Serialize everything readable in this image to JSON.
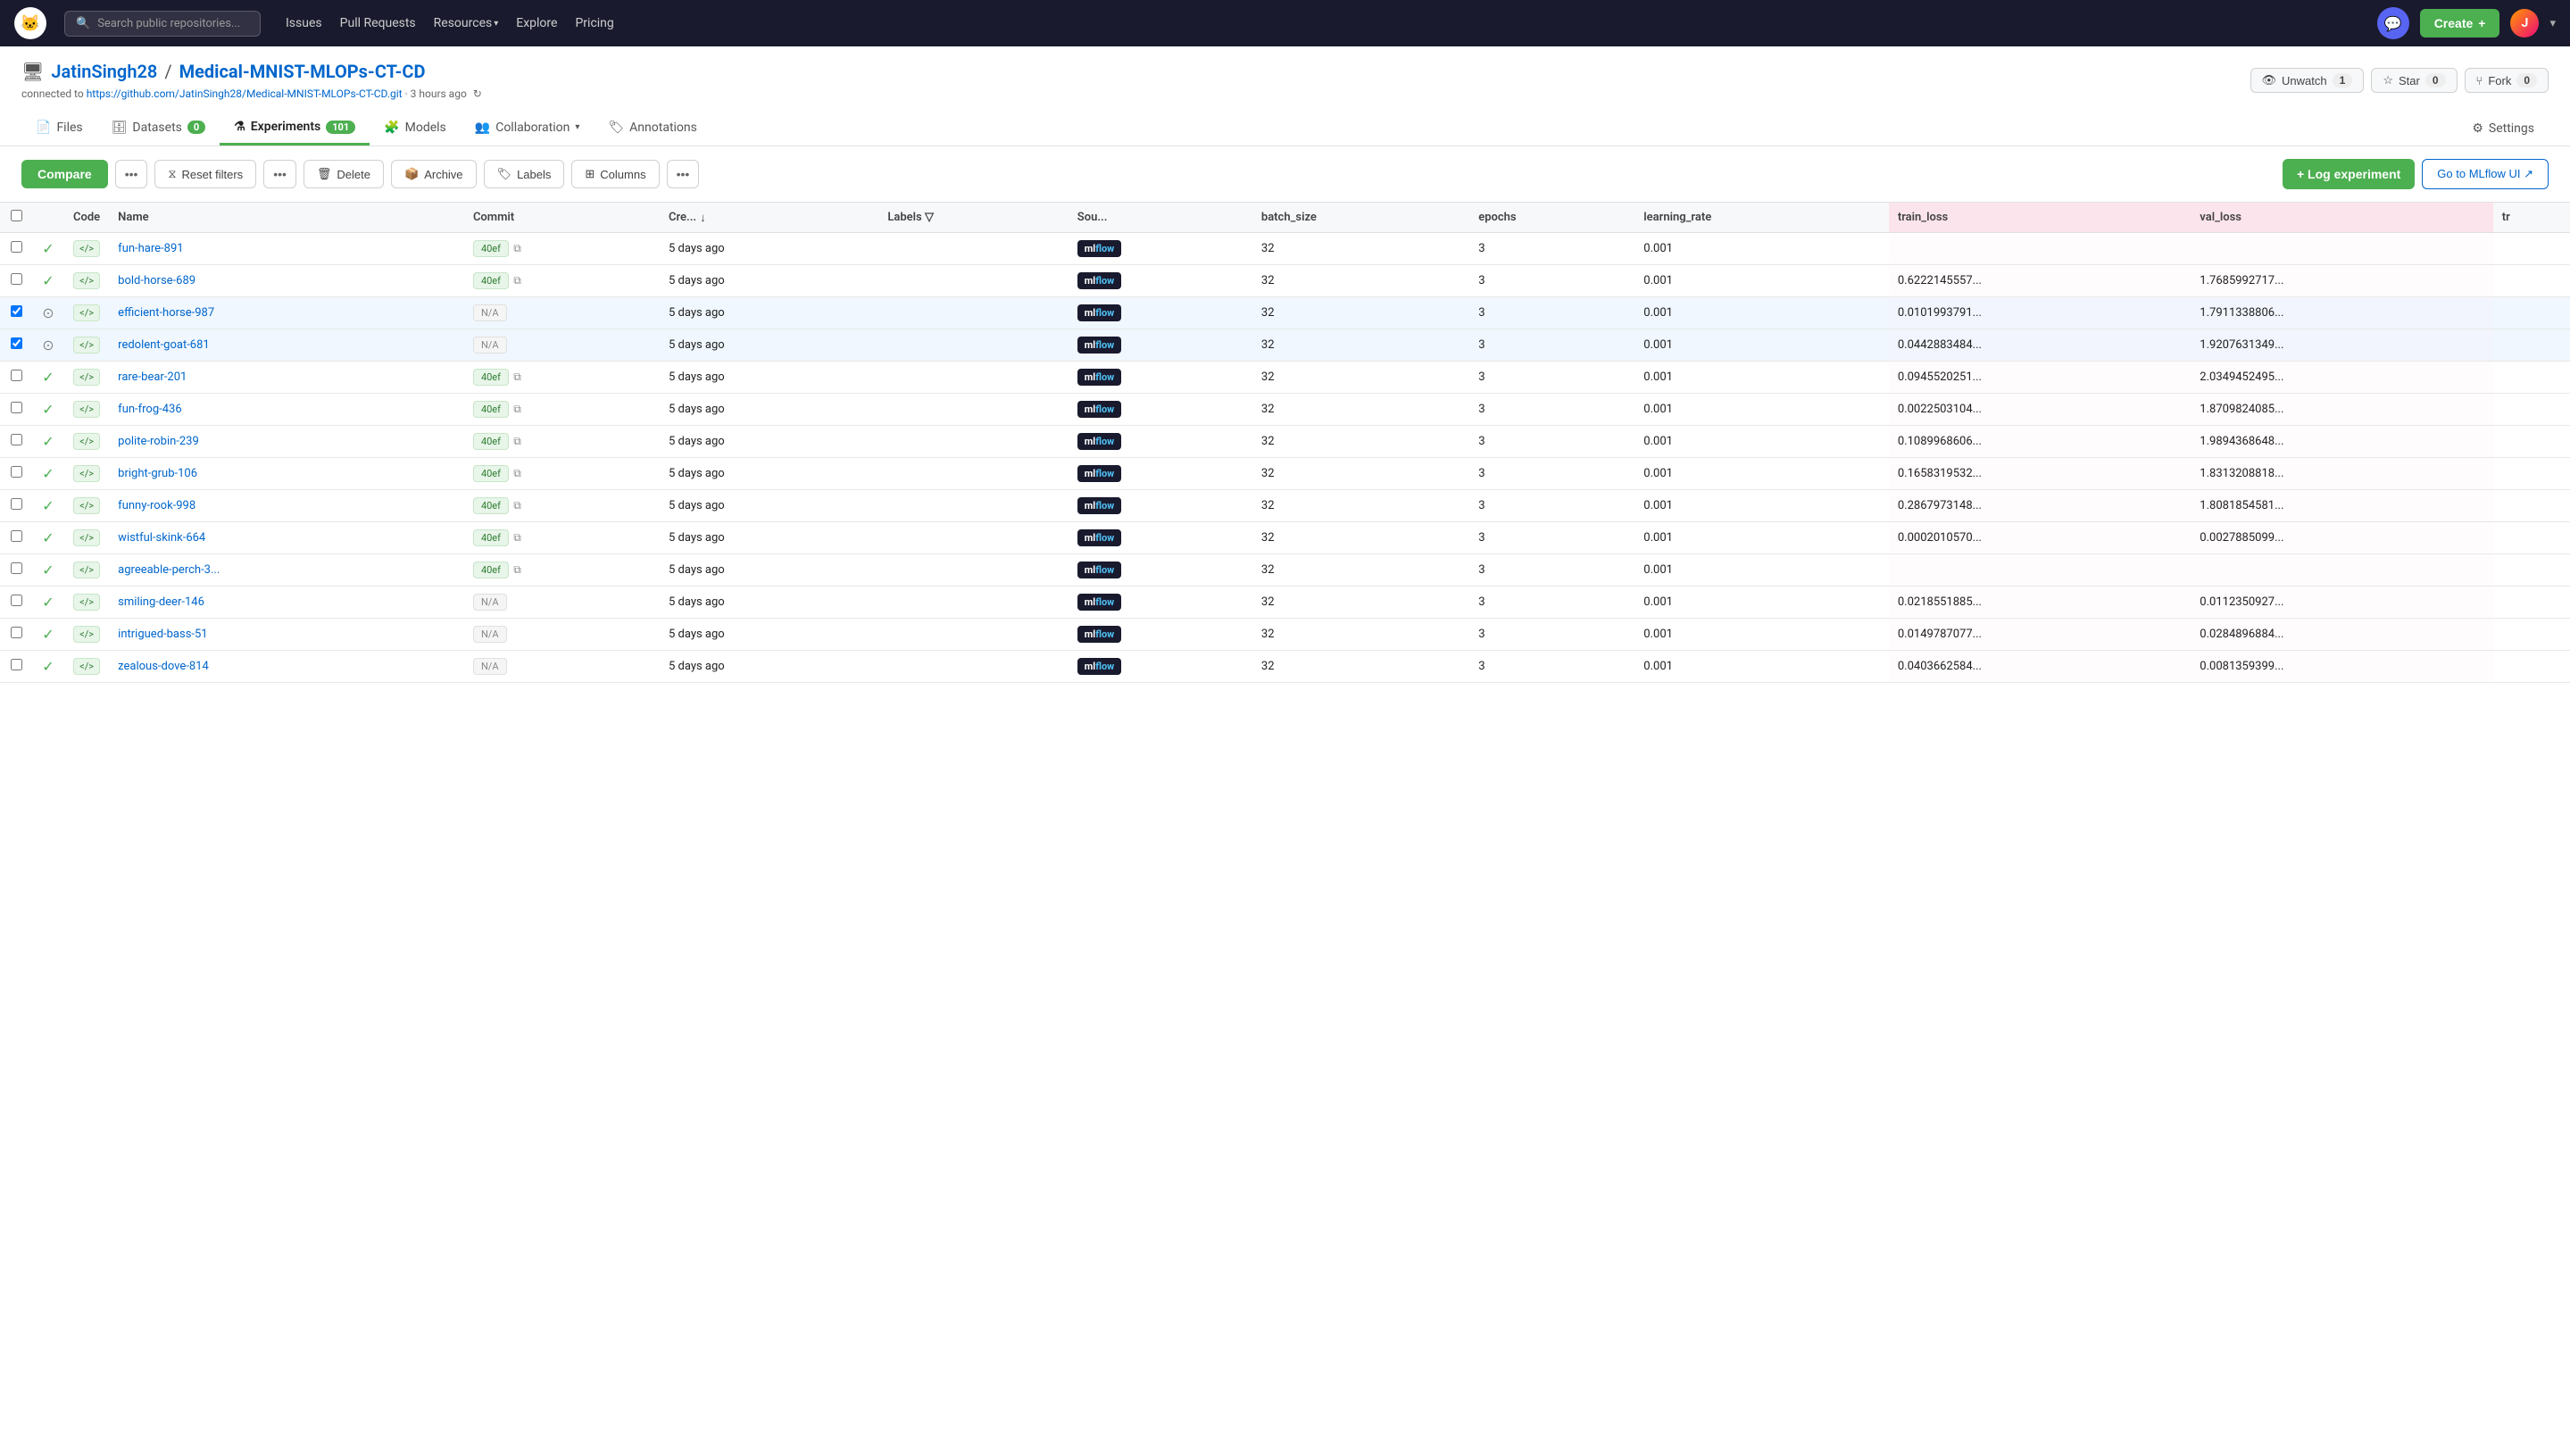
{
  "nav": {
    "search_placeholder": "Search public repositories...",
    "links": [
      "Issues",
      "Pull Requests",
      "Resources",
      "Explore",
      "Pricing"
    ],
    "create_label": "Create",
    "create_icon": "+"
  },
  "repo": {
    "owner": "JatinSingh28",
    "name": "Medical-MNIST-MLOPs-CT-CD",
    "icon": "🖥",
    "github_link": "https://github.com/JatinSingh28/Medical-MNIST-MLOPs-CT-CD.git",
    "time_ago": "3 hours ago",
    "unwatch_label": "Unwatch",
    "unwatch_count": "1",
    "star_label": "Star",
    "star_count": "0",
    "fork_label": "Fork",
    "fork_count": "0"
  },
  "tabs": [
    {
      "label": "Files",
      "icon": "📄",
      "active": false
    },
    {
      "label": "Datasets",
      "icon": "🗄",
      "badge": "0",
      "active": false
    },
    {
      "label": "Experiments",
      "icon": "⚗",
      "badge": "101",
      "active": true
    },
    {
      "label": "Models",
      "icon": "🧩",
      "active": false
    },
    {
      "label": "Collaboration",
      "icon": "👥",
      "dropdown": true,
      "active": false
    },
    {
      "label": "Annotations",
      "icon": "🏷",
      "active": false
    }
  ],
  "settings_label": "Settings",
  "toolbar": {
    "compare_label": "Compare",
    "reset_filters_label": "Reset filters",
    "delete_label": "Delete",
    "archive_label": "Archive",
    "labels_label": "Labels",
    "columns_label": "Columns",
    "log_experiment_label": "+ Log experiment",
    "mlflow_label": "Go to MLflow UI ↗"
  },
  "table": {
    "headers": [
      "",
      "",
      "",
      "Code",
      "Name",
      "Commit",
      "Cre...",
      "Labels",
      "Sou...",
      "batch_size",
      "epochs",
      "learning_rate",
      "train_loss",
      "val_loss",
      "tr"
    ],
    "rows": [
      {
        "selected": false,
        "status": "done",
        "name": "fun-hare-891",
        "commit": "40ef",
        "commit_copy": true,
        "created": "5 days ago",
        "source": "mlflow",
        "batch_size": "32",
        "epochs": "3",
        "learning_rate": "0.001",
        "train_loss": "",
        "val_loss": ""
      },
      {
        "selected": false,
        "status": "done",
        "name": "bold-horse-689",
        "commit": "40ef",
        "commit_copy": true,
        "created": "5 days ago",
        "source": "mlflow",
        "batch_size": "32",
        "epochs": "3",
        "learning_rate": "0.001",
        "train_loss": "0.6222145557...",
        "val_loss": "1.7685992717..."
      },
      {
        "selected": true,
        "status": "running",
        "name": "efficient-horse-987",
        "commit": "N/A",
        "commit_copy": false,
        "created": "5 days ago",
        "source": "mlflow",
        "batch_size": "32",
        "epochs": "3",
        "learning_rate": "0.001",
        "train_loss": "0.0101993791...",
        "val_loss": "1.7911338806..."
      },
      {
        "selected": true,
        "status": "running",
        "name": "redolent-goat-681",
        "commit": "N/A",
        "commit_copy": false,
        "created": "5 days ago",
        "source": "mlflow",
        "batch_size": "32",
        "epochs": "3",
        "learning_rate": "0.001",
        "train_loss": "0.0442883484...",
        "val_loss": "1.9207631349..."
      },
      {
        "selected": false,
        "status": "done",
        "name": "rare-bear-201",
        "commit": "40ef",
        "commit_copy": true,
        "created": "5 days ago",
        "source": "mlflow",
        "batch_size": "32",
        "epochs": "3",
        "learning_rate": "0.001",
        "train_loss": "0.0945520251...",
        "val_loss": "2.0349452495..."
      },
      {
        "selected": false,
        "status": "done",
        "name": "fun-frog-436",
        "commit": "40ef",
        "commit_copy": true,
        "created": "5 days ago",
        "source": "mlflow",
        "batch_size": "32",
        "epochs": "3",
        "learning_rate": "0.001",
        "train_loss": "0.0022503104...",
        "val_loss": "1.8709824085..."
      },
      {
        "selected": false,
        "status": "done",
        "name": "polite-robin-239",
        "commit": "40ef",
        "commit_copy": true,
        "created": "5 days ago",
        "source": "mlflow",
        "batch_size": "32",
        "epochs": "3",
        "learning_rate": "0.001",
        "train_loss": "0.1089968606...",
        "val_loss": "1.9894368648..."
      },
      {
        "selected": false,
        "status": "done",
        "name": "bright-grub-106",
        "commit": "40ef",
        "commit_copy": true,
        "created": "5 days ago",
        "source": "mlflow",
        "batch_size": "32",
        "epochs": "3",
        "learning_rate": "0.001",
        "train_loss": "0.1658319532...",
        "val_loss": "1.8313208818..."
      },
      {
        "selected": false,
        "status": "done",
        "name": "funny-rook-998",
        "commit": "40ef",
        "commit_copy": true,
        "created": "5 days ago",
        "source": "mlflow",
        "batch_size": "32",
        "epochs": "3",
        "learning_rate": "0.001",
        "train_loss": "0.2867973148...",
        "val_loss": "1.8081854581..."
      },
      {
        "selected": false,
        "status": "done",
        "name": "wistful-skink-664",
        "commit": "40ef",
        "commit_copy": true,
        "created": "5 days ago",
        "source": "mlflow",
        "batch_size": "32",
        "epochs": "3",
        "learning_rate": "0.001",
        "train_loss": "0.0002010570...",
        "val_loss": "0.0027885099..."
      },
      {
        "selected": false,
        "status": "done",
        "name": "agreeable-perch-3...",
        "commit": "40ef",
        "commit_copy": true,
        "created": "5 days ago",
        "source": "mlflow",
        "batch_size": "32",
        "epochs": "3",
        "learning_rate": "0.001",
        "train_loss": "",
        "val_loss": ""
      },
      {
        "selected": false,
        "status": "done",
        "name": "smiling-deer-146",
        "commit": "N/A",
        "commit_copy": false,
        "created": "5 days ago",
        "source": "mlflow",
        "batch_size": "32",
        "epochs": "3",
        "learning_rate": "0.001",
        "train_loss": "0.0218551885...",
        "val_loss": "0.0112350927..."
      },
      {
        "selected": false,
        "status": "done",
        "name": "intrigued-bass-51",
        "commit": "N/A",
        "commit_copy": false,
        "created": "5 days ago",
        "source": "mlflow",
        "batch_size": "32",
        "epochs": "3",
        "learning_rate": "0.001",
        "train_loss": "0.0149787077...",
        "val_loss": "0.0284896884..."
      },
      {
        "selected": false,
        "status": "done",
        "name": "zealous-dove-814",
        "commit": "N/A",
        "commit_copy": false,
        "created": "5 days ago",
        "source": "mlflow",
        "batch_size": "32",
        "epochs": "3",
        "learning_rate": "0.001",
        "train_loss": "0.0403662584...",
        "val_loss": "0.0081359399..."
      }
    ]
  }
}
